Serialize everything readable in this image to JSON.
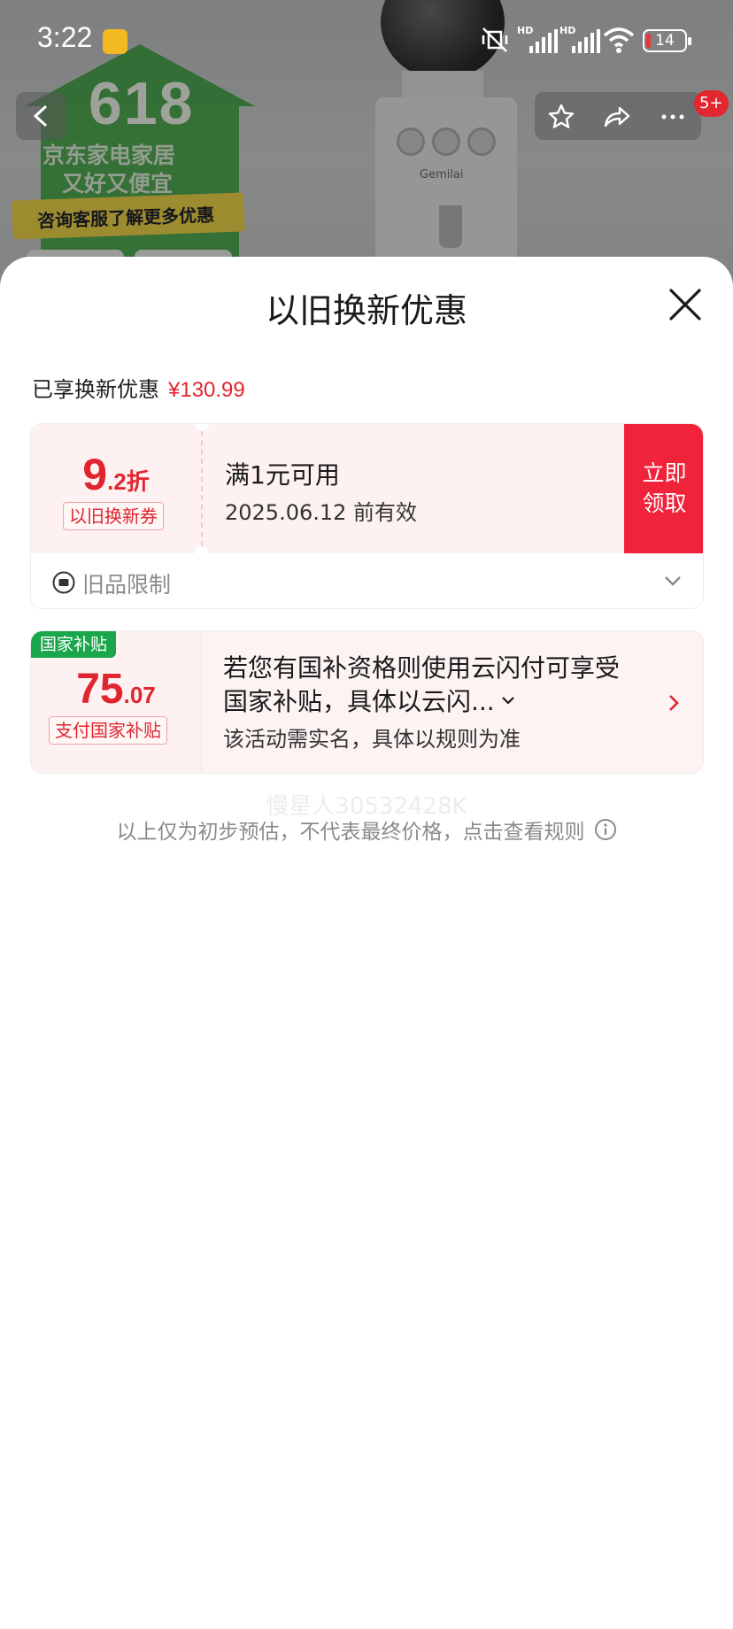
{
  "status_bar": {
    "time": "3:22",
    "battery": "14",
    "hd1": "HD",
    "hd2": "HD"
  },
  "background": {
    "promo_number": "618",
    "promo_line1": "京东家电家居",
    "promo_line2": "又好又便宜",
    "promo_banner": "咨询客服了解更多优惠",
    "product_brand": "Gemilai",
    "cart_badge": "5+"
  },
  "sheet": {
    "title": "以旧换新优惠"
  },
  "savings": {
    "label": "已享换新优惠",
    "amount": "¥130.99"
  },
  "coupon": {
    "discount_major": "9",
    "discount_minor": ".2折",
    "tag": "以旧换新券",
    "condition": "满1元可用",
    "expiry": "2025.06.12 前有效",
    "claim_line1": "立即",
    "claim_line2": "领取",
    "limit_label": "旧品限制"
  },
  "subsidy": {
    "badge": "国家补贴",
    "amount_major": "75",
    "amount_minor": ".07",
    "tag": "支付国家补贴",
    "line1": "若您有国补资格则使用云闪付可享受",
    "line2": "国家补贴，具体以云闪...",
    "line3": "该活动需实名，具体以规则为准"
  },
  "watermark": "慢星人30532428K",
  "footer_note": "以上仅为初步预估，不代表最终价格，点击查看规则",
  "colors": {
    "accent_red": "#e1252f",
    "claim_red": "#f0233a",
    "green": "#1aa64b"
  },
  "icons": [
    "back-icon",
    "star-icon",
    "share-icon",
    "more-icon",
    "close-icon",
    "chevron-down-icon",
    "chevron-right-icon",
    "info-icon",
    "limit-icon"
  ]
}
